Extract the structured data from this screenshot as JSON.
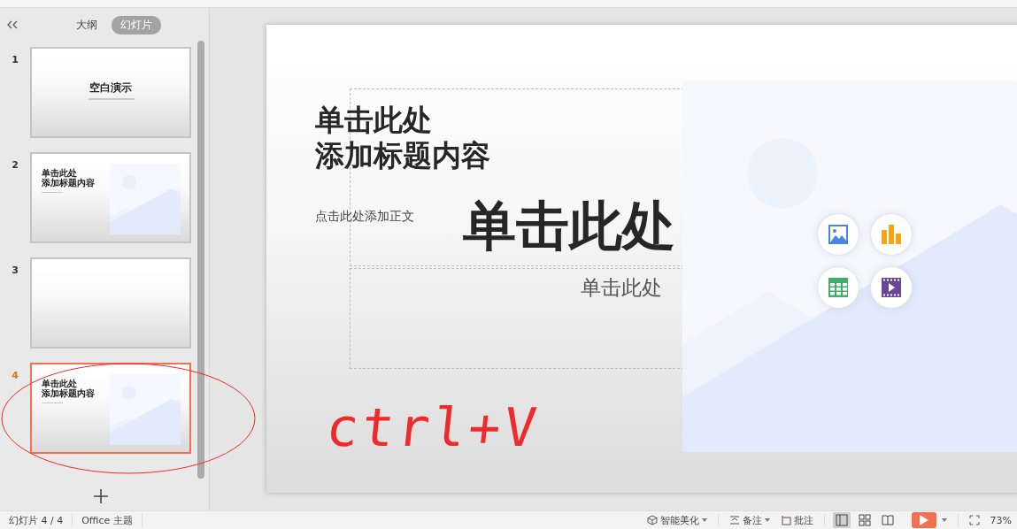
{
  "sidebar": {
    "tabs": [
      {
        "label": "大纲",
        "selected": false
      },
      {
        "label": "幻灯片",
        "selected": true
      }
    ],
    "slides": [
      {
        "number": "1",
        "kind": "cover",
        "title_lines": [
          "空白演示"
        ],
        "selected": false
      },
      {
        "number": "2",
        "kind": "title-image",
        "title_lines": [
          "单击此处",
          "添加标题内容"
        ],
        "selected": false
      },
      {
        "number": "3",
        "kind": "blank",
        "selected": false
      },
      {
        "number": "4",
        "kind": "title-image",
        "title_lines": [
          "单击此处",
          "添加标题内容"
        ],
        "selected": true
      }
    ]
  },
  "slide": {
    "title_lines": [
      "单击此处",
      "添加标题内容"
    ],
    "body": "点击此处添加正文",
    "pasted_title": "单击此处",
    "pasted_subtitle": "单击此处",
    "insert_buttons": [
      {
        "kind": "picture"
      },
      {
        "kind": "chart"
      },
      {
        "kind": "table"
      },
      {
        "kind": "video"
      }
    ]
  },
  "annotation": {
    "text": "ctrl+V"
  },
  "status_bar": {
    "slide_counter": "幻灯片 4 / 4",
    "theme": "Office 主题",
    "beautify": "智能美化",
    "notes": "备注",
    "comments": "批注",
    "views": [
      {
        "kind": "normal",
        "selected": true
      },
      {
        "kind": "sorter",
        "selected": false
      },
      {
        "kind": "reading",
        "selected": false
      }
    ],
    "zoom": "73%"
  }
}
